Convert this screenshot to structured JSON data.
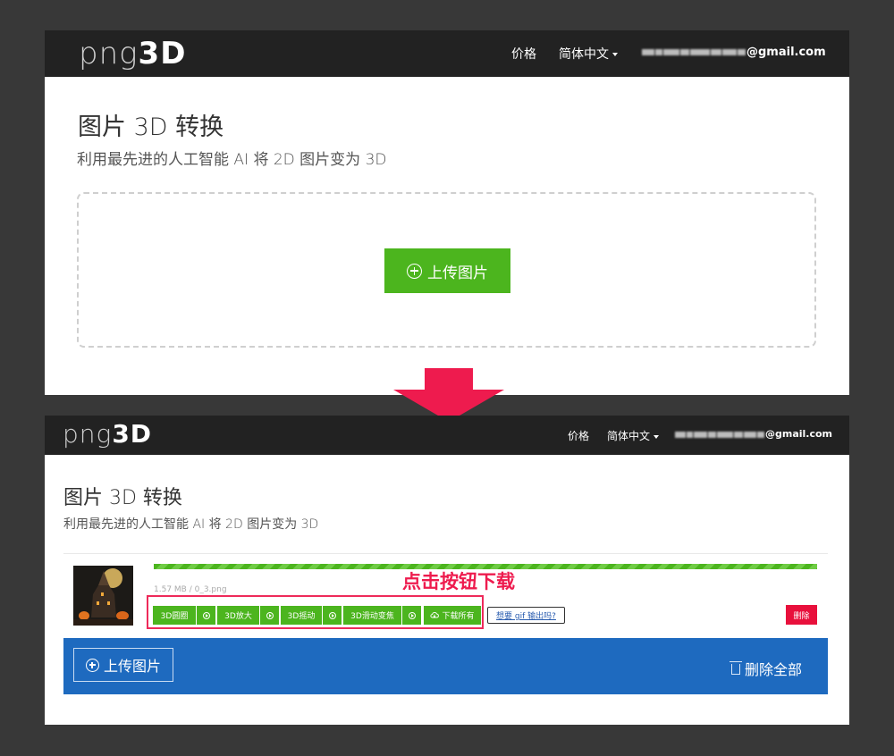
{
  "logo": {
    "thin": "png",
    "bold": "3D"
  },
  "nav": {
    "price": "价格",
    "language": "简体中文",
    "email_suffix": "@gmail.com"
  },
  "top": {
    "title": "图片 3D 转换",
    "subtitle": "利用最先进的人工智能 AI 将 2D 图片变为 3D",
    "upload_label": "上传图片"
  },
  "bottom": {
    "title": "图片 3D 转换",
    "subtitle": "利用最先进的人工智能 AI 将 2D 图片变为 3D",
    "file_info": "1.57 MB / 0_3.png",
    "annotation": "点击按钮下载",
    "buttons": {
      "circle": "3D圆圈",
      "zoom": "3D放大",
      "shake": "3D摇动",
      "dolly": "3D滑动变焦",
      "download_all": "下载所有"
    },
    "gif_link": "想要 gif 输出吗?",
    "delete_one": "删除",
    "upload_label": "上传图片",
    "delete_all": "删除全部"
  },
  "colors": {
    "green": "#4cb51e",
    "blue": "#1e6abf",
    "red": "#e8103c",
    "annotation": "#ee1b4e",
    "nav": "#222222"
  },
  "icons": [
    "plus-circle-icon",
    "play-circle-icon",
    "cloud-download-icon",
    "trash-icon",
    "caret-down-icon",
    "arrow-down-icon"
  ]
}
